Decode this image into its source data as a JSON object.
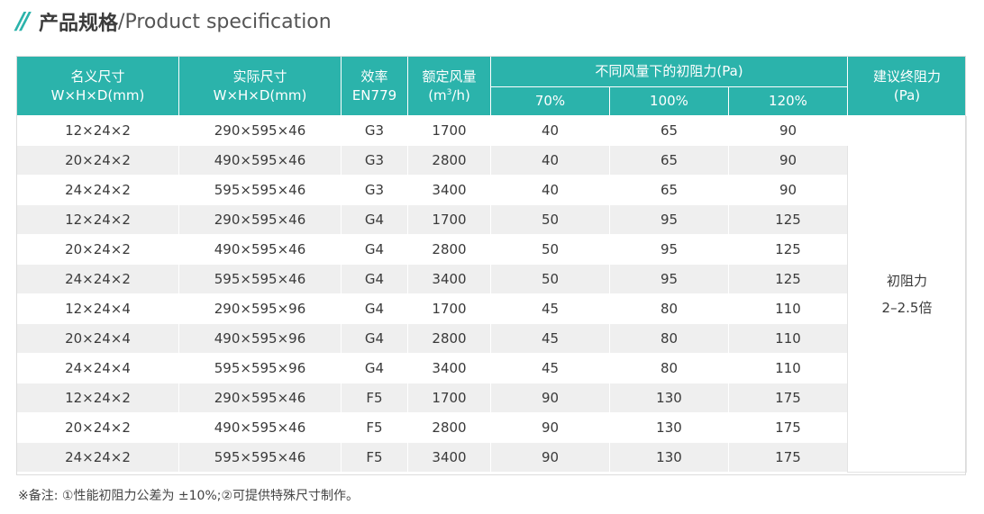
{
  "title": {
    "zh": "产品规格",
    "sep": "/",
    "en": "Product specification"
  },
  "header": {
    "nominal_size": {
      "line1": "名义尺寸",
      "line2": "W×H×D(mm)"
    },
    "actual_size": {
      "line1": "实际尺寸",
      "line2": "W×H×D(mm)"
    },
    "efficiency": {
      "line1": "效率",
      "line2": "EN779"
    },
    "airflow": {
      "line1": "额定风量",
      "unit_pre": "(m",
      "unit_sup": "3",
      "unit_post": "/h)"
    },
    "initial_resistance_group": "不同风量下的初阻力(Pa)",
    "sub_cols": [
      "70%",
      "100%",
      "120%"
    ],
    "final_resistance": {
      "line1": "建议终阻力",
      "line2": "(Pa)"
    }
  },
  "rows": [
    [
      "12×24×2",
      "290×595×46",
      "G3",
      "1700",
      "40",
      "65",
      "90"
    ],
    [
      "20×24×2",
      "490×595×46",
      "G3",
      "2800",
      "40",
      "65",
      "90"
    ],
    [
      "24×24×2",
      "595×595×46",
      "G3",
      "3400",
      "40",
      "65",
      "90"
    ],
    [
      "12×24×2",
      "290×595×46",
      "G4",
      "1700",
      "50",
      "95",
      "125"
    ],
    [
      "20×24×2",
      "490×595×46",
      "G4",
      "2800",
      "50",
      "95",
      "125"
    ],
    [
      "24×24×2",
      "595×595×46",
      "G4",
      "3400",
      "50",
      "95",
      "125"
    ],
    [
      "12×24×4",
      "290×595×96",
      "G4",
      "1700",
      "45",
      "80",
      "110"
    ],
    [
      "20×24×4",
      "490×595×96",
      "G4",
      "2800",
      "45",
      "80",
      "110"
    ],
    [
      "24×24×4",
      "595×595×96",
      "G4",
      "3400",
      "45",
      "80",
      "110"
    ],
    [
      "12×24×2",
      "290×595×46",
      "F5",
      "1700",
      "90",
      "130",
      "175"
    ],
    [
      "20×24×2",
      "490×595×46",
      "F5",
      "2800",
      "90",
      "130",
      "175"
    ],
    [
      "24×24×2",
      "595×595×46",
      "F5",
      "3400",
      "90",
      "130",
      "175"
    ]
  ],
  "final_resistance_value": {
    "line1": "初阻力",
    "line2": "2–2.5倍"
  },
  "note": "※备注: ①性能初阻力公差为 ±10%;②可提供特殊尺寸制作。",
  "colors": {
    "accent": "#2bb3ab",
    "stripe": "#efefef"
  }
}
